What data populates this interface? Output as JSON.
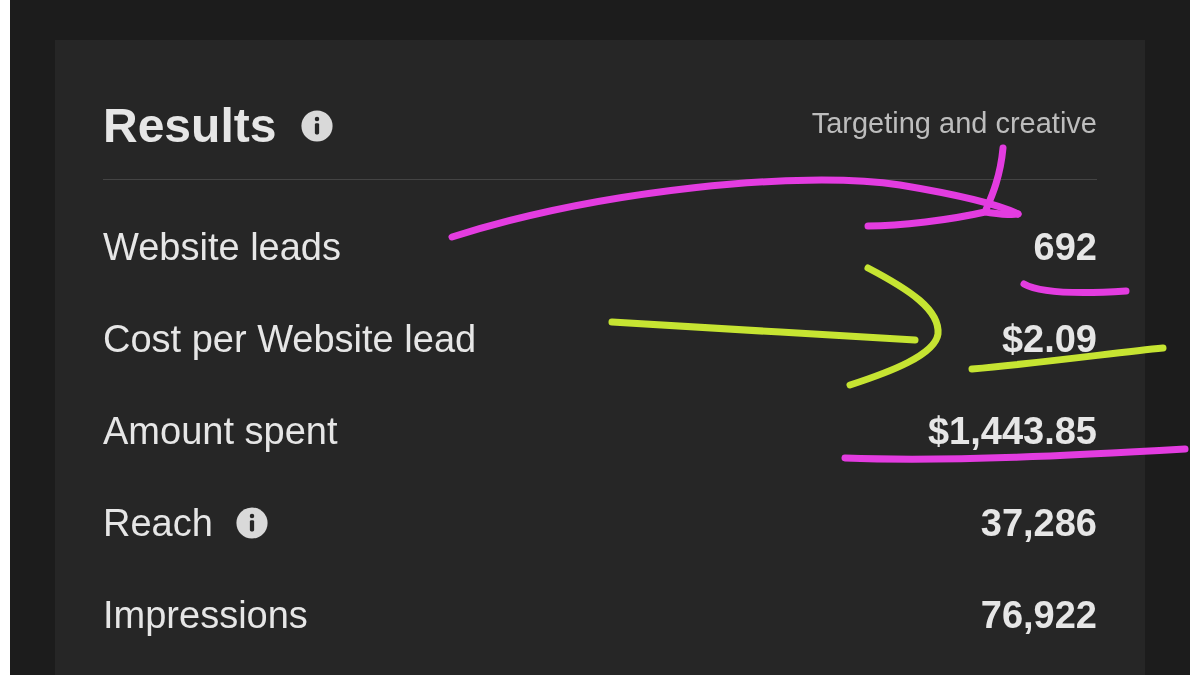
{
  "card": {
    "title": "Results",
    "subtitle": "Targeting and creative",
    "rows": [
      {
        "label": "Website leads",
        "value": "692",
        "info": false
      },
      {
        "label": "Cost per Website lead",
        "value": "$2.09",
        "info": false
      },
      {
        "label": "Amount spent",
        "value": "$1,443.85",
        "info": false
      },
      {
        "label": "Reach",
        "value": "37,286",
        "info": true
      },
      {
        "label": "Impressions",
        "value": "76,922",
        "info": false
      }
    ]
  }
}
